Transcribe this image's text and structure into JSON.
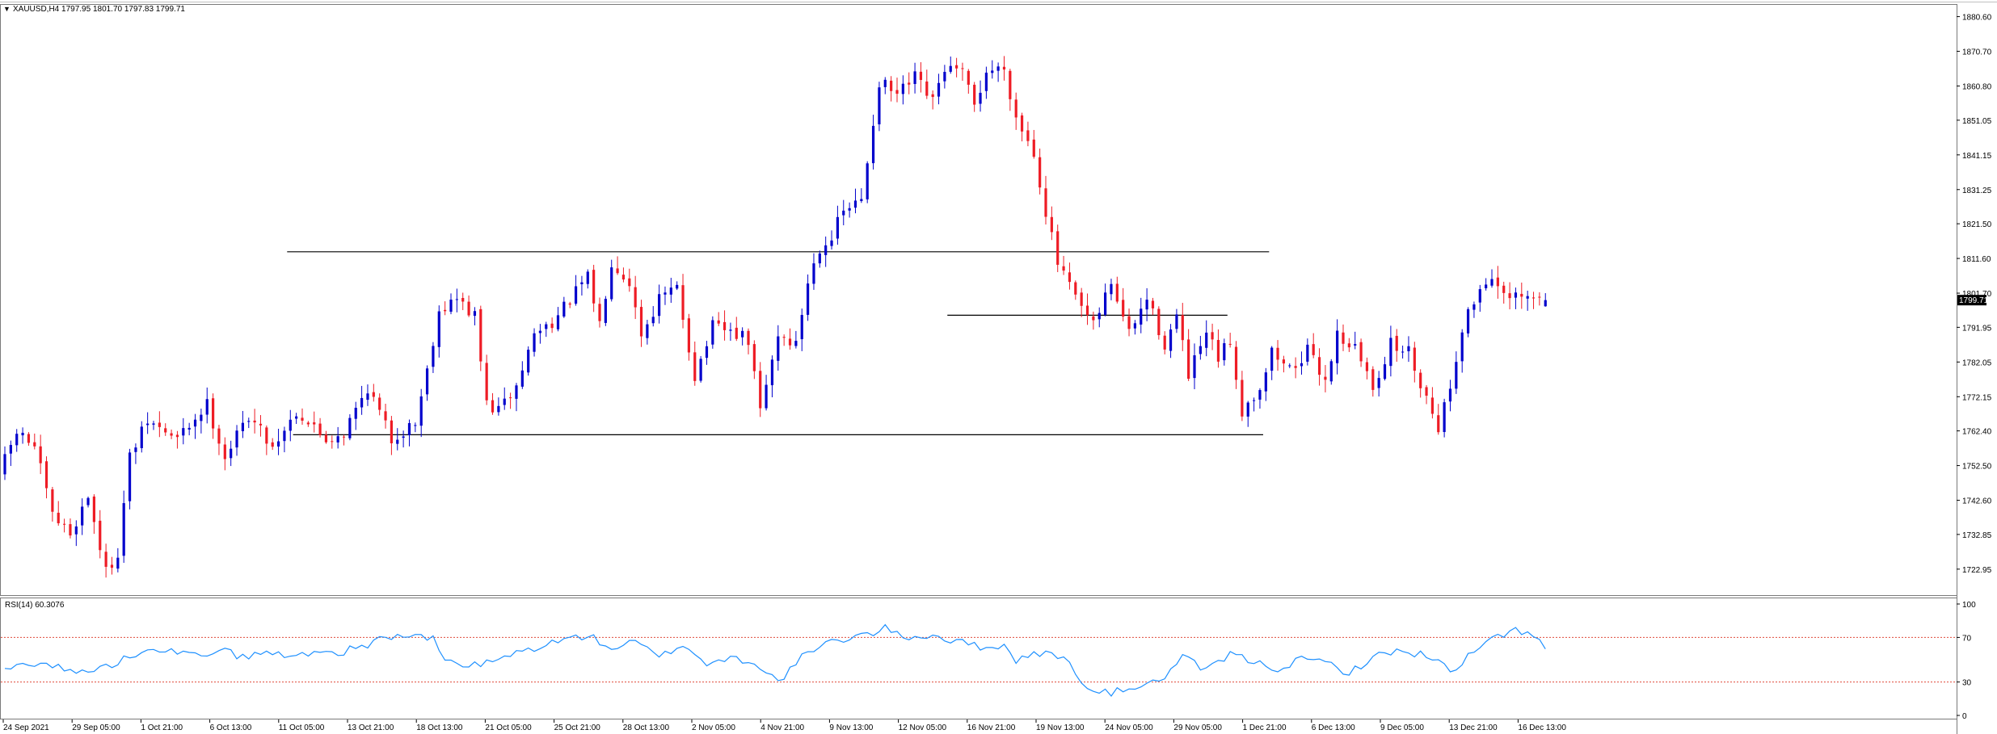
{
  "header": {
    "symbol_text": "XAUUSD,H4  1797.95 1801.70 1797.83 1799.71",
    "collapse_glyph": "▼"
  },
  "rsi_panel": {
    "title_text": "RSI(14) 60.3076",
    "levels": [
      100,
      70,
      30,
      0
    ],
    "level_labels": [
      "100",
      "70",
      "30",
      "0"
    ],
    "overbought": 70,
    "oversold": 30
  },
  "price_panel": {
    "current_price_label": "1799.71",
    "current_price": 1799.71
  },
  "colors": {
    "bull": "#0000cc",
    "bear": "#ee1c25",
    "rsi_line": "#1e90ff",
    "level_line": "#e04b3a",
    "price_tag_bg": "#000000"
  },
  "chart_data": {
    "type": "candlestick",
    "title": "XAUUSD,H4",
    "ohlc_header": {
      "open": 1797.95,
      "high": 1801.7,
      "low": 1797.83,
      "close": 1799.71
    },
    "y_ticks": [
      "1880.60",
      "1870.70",
      "1860.80",
      "1851.05",
      "1841.15",
      "1831.25",
      "1821.50",
      "1811.60",
      "1801.70",
      "1791.95",
      "1782.05",
      "1772.15",
      "1762.40",
      "1752.50",
      "1742.60",
      "1732.85",
      "1722.95"
    ],
    "ylim": [
      1716.0,
      1883.5
    ],
    "x_ticks": [
      "24 Sep 2021",
      "29 Sep 05:00",
      "1 Oct 21:00",
      "6 Oct 13:00",
      "11 Oct 05:00",
      "13 Oct 21:00",
      "18 Oct 13:00",
      "21 Oct 05:00",
      "25 Oct 21:00",
      "28 Oct 13:00",
      "2 Nov 05:00",
      "4 Nov 21:00",
      "9 Nov 13:00",
      "12 Nov 05:00",
      "16 Nov 21:00",
      "19 Nov 13:00",
      "24 Nov 05:00",
      "29 Nov 05:00",
      "1 Dec 21:00",
      "6 Dec 13:00",
      "9 Dec 05:00",
      "13 Dec 21:00",
      "16 Dec 13:00"
    ],
    "price_path": [
      [
        0,
        1750
      ],
      [
        3,
        1762
      ],
      [
        6,
        1758
      ],
      [
        9,
        1738
      ],
      [
        12,
        1733
      ],
      [
        15,
        1744
      ],
      [
        18,
        1722
      ],
      [
        20,
        1728
      ],
      [
        22,
        1755
      ],
      [
        25,
        1765
      ],
      [
        30,
        1760
      ],
      [
        35,
        1770
      ],
      [
        38,
        1755
      ],
      [
        42,
        1767
      ],
      [
        46,
        1758
      ],
      [
        50,
        1768
      ],
      [
        55,
        1760
      ],
      [
        58,
        1762
      ],
      [
        62,
        1775
      ],
      [
        66,
        1760
      ],
      [
        70,
        1765
      ],
      [
        72,
        1780
      ],
      [
        74,
        1797
      ],
      [
        77,
        1800
      ],
      [
        80,
        1795
      ],
      [
        82,
        1770
      ],
      [
        84,
        1768
      ],
      [
        87,
        1775
      ],
      [
        90,
        1790
      ],
      [
        94,
        1795
      ],
      [
        97,
        1802
      ],
      [
        99,
        1806
      ],
      [
        101,
        1793
      ],
      [
        103,
        1811
      ],
      [
        106,
        1805
      ],
      [
        108,
        1790
      ],
      [
        111,
        1800
      ],
      [
        114,
        1803
      ],
      [
        117,
        1778
      ],
      [
        120,
        1792
      ],
      [
        124,
        1790
      ],
      [
        126,
        1788
      ],
      [
        128,
        1768
      ],
      [
        131,
        1790
      ],
      [
        134,
        1787
      ],
      [
        136,
        1805
      ],
      [
        138,
        1815
      ],
      [
        140,
        1818
      ],
      [
        142,
        1825
      ],
      [
        145,
        1828
      ],
      [
        148,
        1862
      ],
      [
        151,
        1858
      ],
      [
        154,
        1863
      ],
      [
        157,
        1856
      ],
      [
        159,
        1866
      ],
      [
        162,
        1864
      ],
      [
        164,
        1855
      ],
      [
        166,
        1865
      ],
      [
        169,
        1866
      ],
      [
        171,
        1852
      ],
      [
        174,
        1842
      ],
      [
        176,
        1825
      ],
      [
        178,
        1810
      ],
      [
        181,
        1800
      ],
      [
        184,
        1792
      ],
      [
        187,
        1805
      ],
      [
        190,
        1790
      ],
      [
        193,
        1800
      ],
      [
        196,
        1787
      ],
      [
        198,
        1795
      ],
      [
        200,
        1778
      ],
      [
        203,
        1790
      ],
      [
        205,
        1783
      ],
      [
        207,
        1788
      ],
      [
        209,
        1768
      ],
      [
        212,
        1775
      ],
      [
        214,
        1785
      ],
      [
        217,
        1780
      ],
      [
        220,
        1785
      ],
      [
        223,
        1777
      ],
      [
        225,
        1790
      ],
      [
        228,
        1786
      ],
      [
        231,
        1775
      ],
      [
        234,
        1787
      ],
      [
        237,
        1785
      ],
      [
        240,
        1772
      ],
      [
        242,
        1764
      ],
      [
        244,
        1775
      ],
      [
        246,
        1792
      ],
      [
        249,
        1803
      ],
      [
        251,
        1807
      ],
      [
        253,
        1800
      ]
    ],
    "rsi_path": [
      [
        0,
        40
      ],
      [
        4,
        48
      ],
      [
        8,
        45
      ],
      [
        12,
        38
      ],
      [
        16,
        42
      ],
      [
        20,
        50
      ],
      [
        24,
        62
      ],
      [
        28,
        58
      ],
      [
        32,
        53
      ],
      [
        36,
        60
      ],
      [
        40,
        52
      ],
      [
        44,
        57
      ],
      [
        48,
        52
      ],
      [
        52,
        58
      ],
      [
        56,
        56
      ],
      [
        60,
        62
      ],
      [
        64,
        70
      ],
      [
        68,
        72
      ],
      [
        72,
        68
      ],
      [
        74,
        50
      ],
      [
        78,
        44
      ],
      [
        82,
        48
      ],
      [
        86,
        56
      ],
      [
        90,
        62
      ],
      [
        94,
        68
      ],
      [
        98,
        72
      ],
      [
        102,
        60
      ],
      [
        106,
        66
      ],
      [
        110,
        52
      ],
      [
        114,
        64
      ],
      [
        118,
        46
      ],
      [
        122,
        52
      ],
      [
        126,
        48
      ],
      [
        130,
        30
      ],
      [
        134,
        52
      ],
      [
        138,
        64
      ],
      [
        142,
        70
      ],
      [
        146,
        74
      ],
      [
        148,
        78
      ],
      [
        152,
        70
      ],
      [
        156,
        72
      ],
      [
        160,
        66
      ],
      [
        164,
        62
      ],
      [
        168,
        62
      ],
      [
        170,
        50
      ],
      [
        174,
        56
      ],
      [
        178,
        52
      ],
      [
        180,
        40
      ],
      [
        182,
        22
      ],
      [
        186,
        20
      ],
      [
        190,
        26
      ],
      [
        194,
        30
      ],
      [
        198,
        52
      ],
      [
        202,
        40
      ],
      [
        206,
        55
      ],
      [
        210,
        48
      ],
      [
        214,
        42
      ],
      [
        218,
        50
      ],
      [
        222,
        48
      ],
      [
        226,
        38
      ],
      [
        230,
        52
      ],
      [
        234,
        58
      ],
      [
        238,
        55
      ],
      [
        242,
        45
      ],
      [
        244,
        38
      ],
      [
        246,
        53
      ],
      [
        250,
        68
      ],
      [
        254,
        78
      ],
      [
        257,
        71
      ],
      [
        259,
        60
      ]
    ],
    "n_bars": 260,
    "horizontal_levels": [
      {
        "price": 1813.5,
        "from": 48,
        "to": 212
      },
      {
        "price": 1761.3,
        "from": 49,
        "to": 211
      },
      {
        "price": 1795.4,
        "from": 159,
        "to": 205
      }
    ],
    "last_candle": {
      "open": 1797.95,
      "high": 1801.7,
      "low": 1797.83,
      "close": 1799.71
    }
  }
}
